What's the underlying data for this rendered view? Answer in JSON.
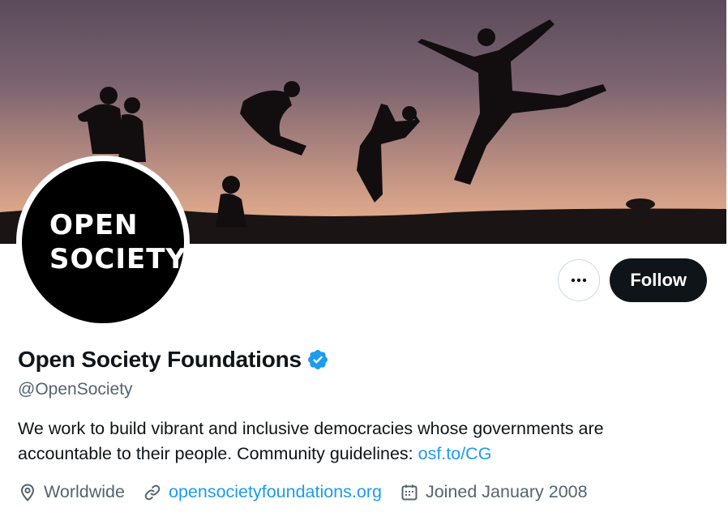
{
  "profile": {
    "avatar_text_line1": "OPEN",
    "avatar_text_line2": "SOCIETY",
    "display_name": "Open Society Foundations",
    "handle": "@OpenSociety",
    "verified": true,
    "bio_text": "We work to build vibrant and inclusive democracies whose governments are accountable to their people. Community guidelines: ",
    "bio_link": "osf.to/CG"
  },
  "actions": {
    "more_icon": "more-horizontal-icon",
    "follow_label": "Follow"
  },
  "meta": {
    "location": "Worldwide",
    "website": "opensocietyfoundations.org",
    "joined": "Joined January 2008"
  },
  "colors": {
    "accent": "#1d9bf0",
    "text_primary": "#0f1419",
    "text_secondary": "#536471",
    "follow_bg": "#0f1419"
  }
}
